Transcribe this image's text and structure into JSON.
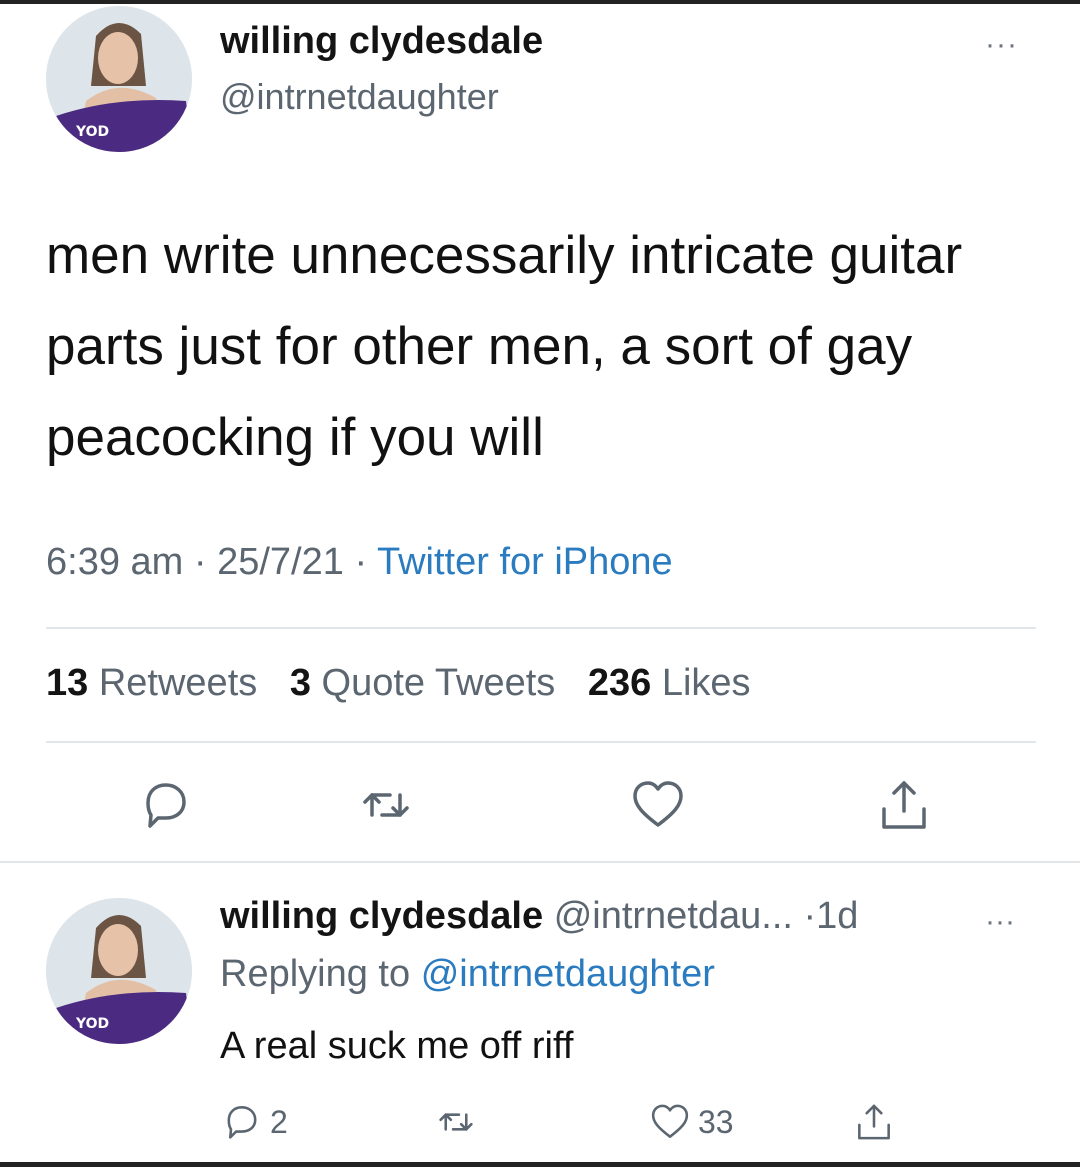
{
  "tweet": {
    "display_name": "willing clydesdale",
    "handle": "@intrnetdaughter",
    "more_label": "···",
    "text": "men write unnecessarily intricate guitar parts just for other men, a sort of gay peacocking if you will",
    "time": "6:39 am",
    "date": "25/7/21",
    "source": "Twitter for iPhone",
    "separator": " · ",
    "stats": {
      "retweets_count": "13",
      "retweets_label": "Retweets",
      "quotes_count": "3",
      "quotes_label": "Quote Tweets",
      "likes_count": "236",
      "likes_label": "Likes"
    },
    "actions": [
      "reply-icon",
      "retweet-icon",
      "like-icon",
      "share-icon"
    ]
  },
  "reply": {
    "display_name": "willing clydesdale",
    "handle": "@intrnetdau...",
    "age": "1d",
    "more_label": "···",
    "replying_prefix": "Replying to",
    "replying_to": "@intrnetdaughter",
    "text": "A real suck me off riff",
    "reply_count": "2",
    "like_count": "33"
  },
  "colors": {
    "link": "#2a7bbf",
    "muted": "#5b6670",
    "avatar_shirt": "#4b2a82"
  }
}
